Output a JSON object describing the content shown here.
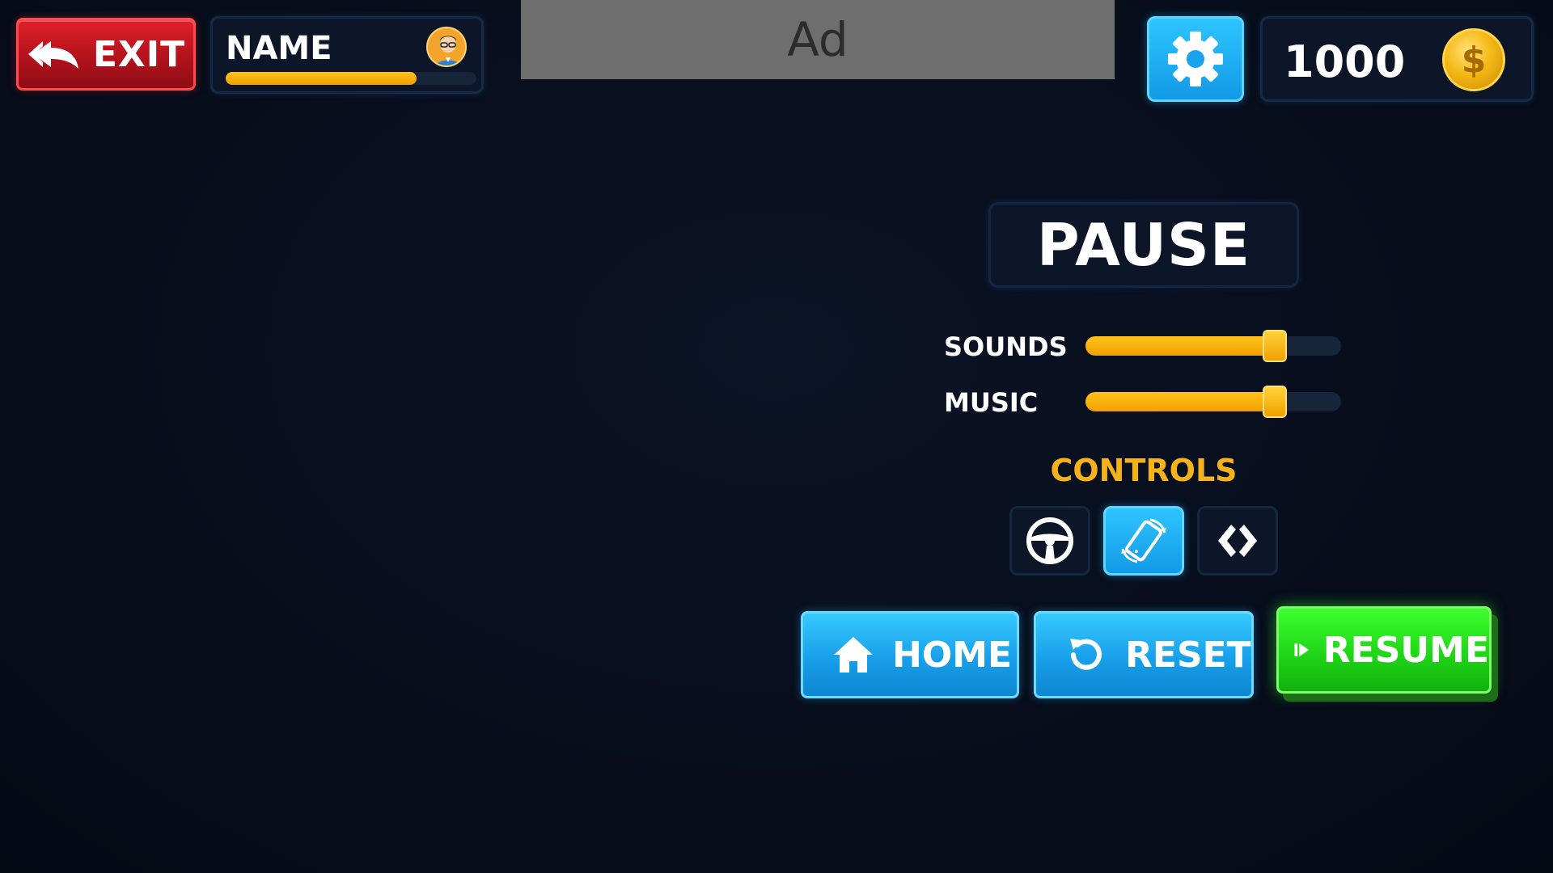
{
  "header": {
    "exit_label": "EXIT",
    "player_name": "NAME",
    "xp_progress": 0.76,
    "ad_label": "Ad",
    "coins": "1000",
    "coin_symbol": "$"
  },
  "pause_menu": {
    "title": "PAUSE",
    "sounds_label": "SOUNDS",
    "sounds_level": 0.74,
    "music_label": "MUSIC",
    "music_level": 0.74,
    "controls_label": "CONTROLS",
    "control_options": [
      {
        "icon": "steering-wheel-icon",
        "active": false
      },
      {
        "icon": "tilt-device-icon",
        "active": true
      },
      {
        "icon": "arrows-icon",
        "active": false
      }
    ],
    "home_label": "HOME",
    "reset_label": "RESET",
    "resume_label": "RESUME"
  },
  "colors": {
    "background": "#070d1b",
    "accent_blue": "#1aa8f0",
    "accent_yellow": "#f6b21a",
    "exit_red": "#c8161f",
    "resume_green": "#22d81a"
  }
}
